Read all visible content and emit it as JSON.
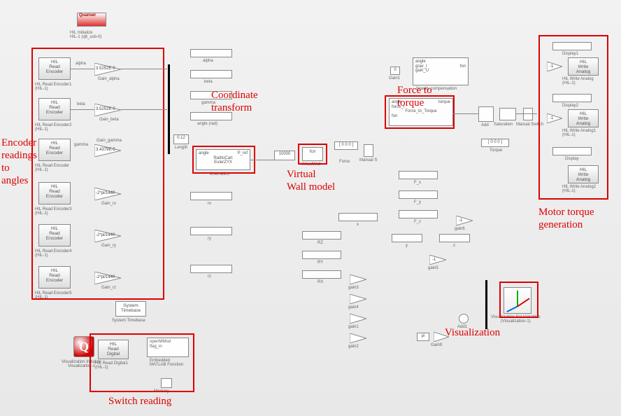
{
  "logos": {
    "quarc": "Quanser"
  },
  "init": {
    "hil_init": "HIL Initialize\nHIL-1 (q8_usb-0)",
    "vis_init": "Visualization Initialize\nVisualization-1"
  },
  "encoders": [
    {
      "name": "HIL\nRead\nEncoder",
      "cap": "HIL Read Encoder1\n(HIL-1)",
      "sig": "alpha",
      "gain": "3.5252E-5",
      "gcap": "Gain_alpha"
    },
    {
      "name": "HIL\nRead\nEncoder",
      "cap": "HIL Read Encoder2\n(HIL-1)",
      "sig": "beta",
      "gain": "3.5252E-5",
      "gcap": "Gain_beta"
    },
    {
      "name": "HIL\nRead\nEncoder",
      "cap": "HIL Read Encoder\n(HIL-1)",
      "sig": "gamma",
      "gain": "3.4379E-5",
      "gcap": "Gain_gamma"
    },
    {
      "name": "HIL\nRead\nEncoder",
      "cap": "HIL Read Encoder3\n(HIL-1)",
      "sig": "",
      "gain": "-2*pi/1440",
      "gcap": "Gain_rx"
    },
    {
      "name": "HIL\nRead\nEncoder",
      "cap": "HIL Read Encoder4\n(HIL-1)",
      "sig": "",
      "gain": "-2*pi/1440",
      "gcap": "Gain_ry"
    },
    {
      "name": "HIL\nRead\nEncoder",
      "cap": "HIL Read Encoder5\n(HIL-1)",
      "sig": "",
      "gain": "-2*pi/1440",
      "gcap": "Gain_rz"
    }
  ],
  "timebase": "System\nTimebase",
  "switchread": {
    "hil": "HIL\nRead\nDigital",
    "hil_cap": "HIL Read Digital1\n(HIL-1)",
    "fcn_ports": [
      "openMMod",
      "flag_in"
    ],
    "fcn_cap": "Embedded\nMATLAB Function",
    "memory": "Memory"
  },
  "displays_left": [
    "alpha",
    "beta",
    "gamma",
    "angle (rad)",
    "rx",
    "ry",
    "rz"
  ],
  "length": {
    "val": "0.12",
    "cap": "Length"
  },
  "kin": {
    "ports": [
      "angle",
      "P_ref"
    ],
    "cap": "kinematics",
    "sub": "RadtoCart\nEulerZYX"
  },
  "virtualwall": {
    "gain": "10000",
    "fcn": "fcn",
    "force": "Force",
    "manual": "Manual S"
  },
  "fcntorque": {
    "name": "Force_to_Torque",
    "ports": [
      "angle",
      "force_I",
      "fon"
    ],
    "out": "torque",
    "cap": "Force to torque"
  },
  "gravity": {
    "ports": [
      "angle",
      "grav_I",
      "fon",
      "gain_U"
    ],
    "cap": "Gravity compensation",
    "const": "0",
    "const_cap": "Gain1"
  },
  "force_const": "[ 0 0 0 ]",
  "torque_lbl": "Torque",
  "torque_const": "[ 0  0  0 ]",
  "add_cap": "Add",
  "sat_cap": "Saturation",
  "manual_switch_cap": "Manual Switch",
  "disp_right_top": [
    "F_x",
    "F_y",
    "F_z"
  ],
  "disp_mid": [
    "x",
    "RZ",
    "RY",
    "RX",
    "y",
    "z"
  ],
  "gains_mid": [
    "gain3",
    "gain4",
    "gain1",
    "gain2",
    "gain5",
    "gain6"
  ],
  "gain_val": "-1",
  "pi": "pi",
  "gain9": "Gain9",
  "add1": "Add1",
  "vis_set": "Visualization Set Variables\n(Visualization-1)",
  "motor": {
    "display": [
      "Display1",
      "Display2",
      "Display"
    ],
    "gain_val": "-1",
    "write": [
      "HIL\nWrite\nAnalog",
      "HIL\nWrite\nAnalog",
      "HIL\nWrite\nAnalog"
    ],
    "write_cap": [
      "HIL Write Analog\n(HIL-1)",
      "HIL Write Analog1\n(HIL-1)",
      "HIL Write Analog2\n(HIL-1)"
    ]
  },
  "ann": {
    "enc": "Encoder\nreadings\nto\nangles",
    "coord": "Coordinate\ntransform",
    "vw": "Virtual\nWall model",
    "ft": "Force to\ntorque",
    "vis": "Visualization",
    "motor": "Motor torque\ngeneration",
    "sw": "Switch reading"
  }
}
